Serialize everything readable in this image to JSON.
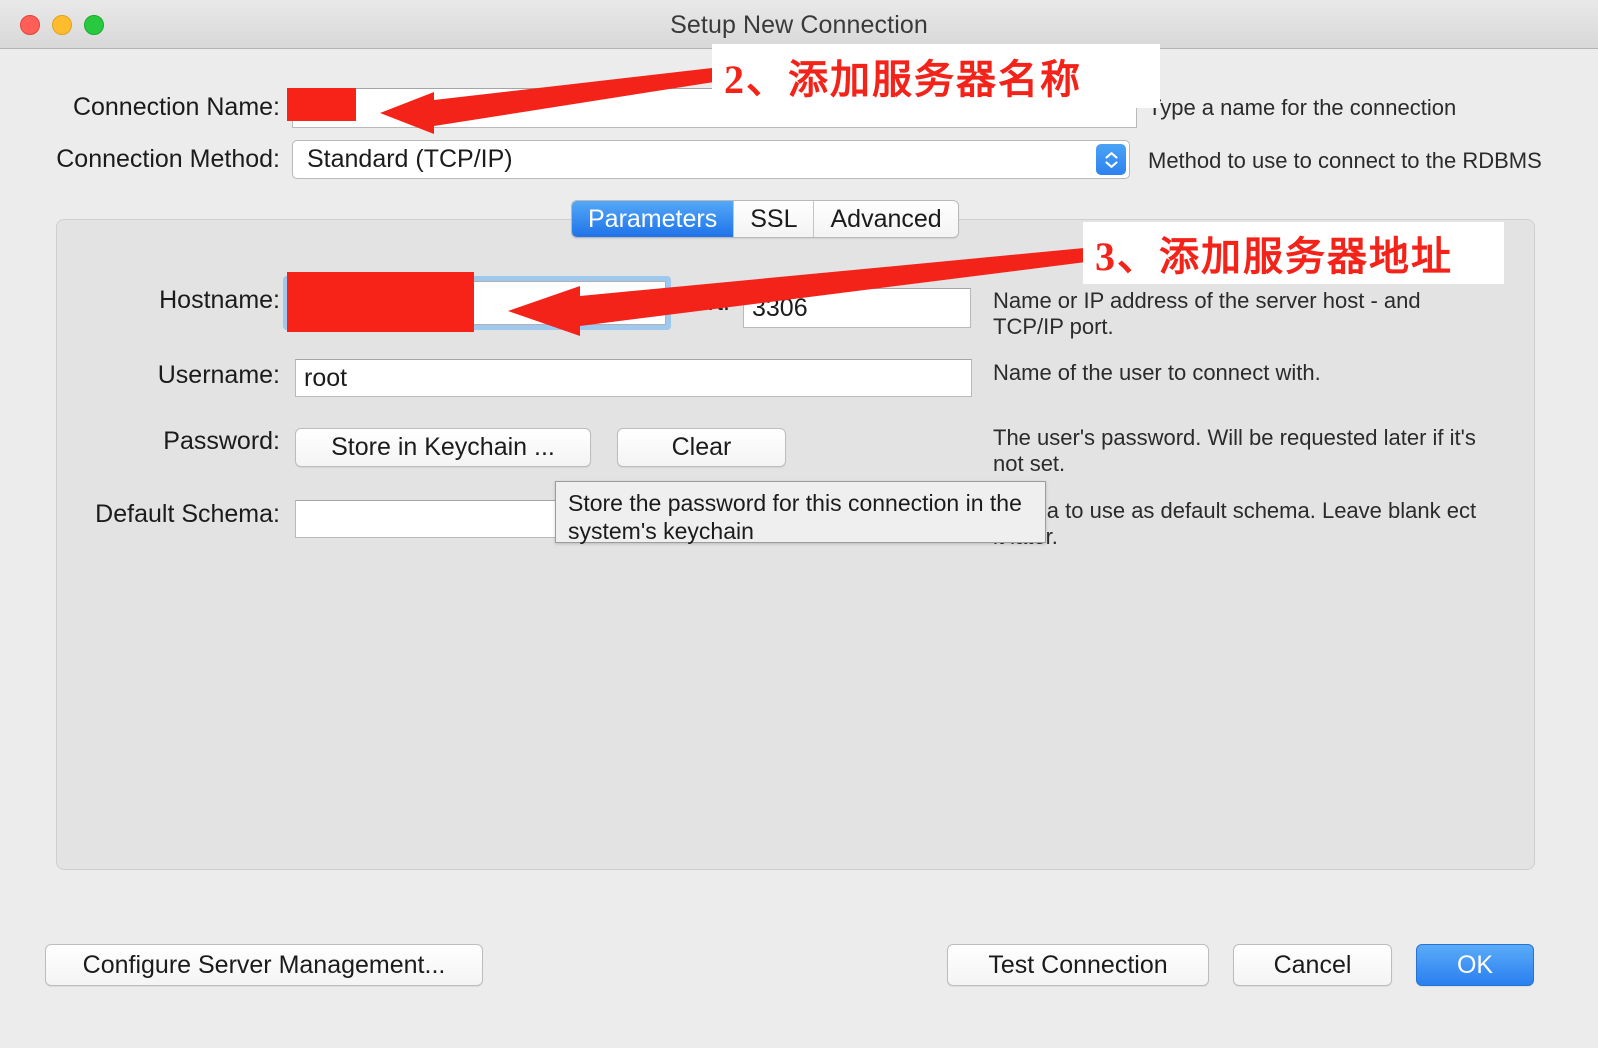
{
  "window": {
    "title": "Setup New Connection",
    "traffic_lights": [
      "close-button",
      "minimize-button",
      "maximize-button"
    ]
  },
  "form": {
    "connection_name": {
      "label": "Connection Name:",
      "value": "",
      "redacted": true,
      "help": "Type a name for the connection"
    },
    "connection_method": {
      "label": "Connection Method:",
      "value": "Standard (TCP/IP)",
      "help": "Method to use to connect to the RDBMS"
    }
  },
  "tabs": [
    {
      "label": "Parameters",
      "active": true
    },
    {
      "label": "SSL",
      "active": false
    },
    {
      "label": "Advanced",
      "active": false
    }
  ],
  "parameters": {
    "hostname": {
      "label": "Hostname:",
      "value": "",
      "redacted": true,
      "focused": true,
      "help": "Name or IP address of the server host - and TCP/IP port."
    },
    "port": {
      "label": "Port:",
      "value": "3306"
    },
    "username": {
      "label": "Username:",
      "value": "root",
      "help": "Name of the user to connect with."
    },
    "password": {
      "label": "Password:",
      "store_button": "Store in Keychain ...",
      "clear_button": "Clear",
      "help": "The user's password. Will be requested later if it's not set."
    },
    "default_schema": {
      "label": "Default Schema:",
      "value": "",
      "help": "chema to use as default schema. Leave blank ect it later."
    }
  },
  "tooltip": {
    "text": "Store the password for this connection in the system's keychain"
  },
  "footer": {
    "configure": "Configure Server Management...",
    "test": "Test Connection",
    "cancel": "Cancel",
    "ok": "OK"
  },
  "annotations": [
    {
      "id": "anno-1",
      "text": "2、添加服务器名称",
      "points_to": "connection-name-field"
    },
    {
      "id": "anno-2",
      "text": "3、添加服务器地址",
      "points_to": "hostname-field"
    }
  ],
  "colors": {
    "accent_blue": "#2a7ff0",
    "annotation_red": "#f4231a",
    "redaction_red": "#f72319",
    "window_bg": "#ececec",
    "panel_bg": "#e3e3e3"
  }
}
